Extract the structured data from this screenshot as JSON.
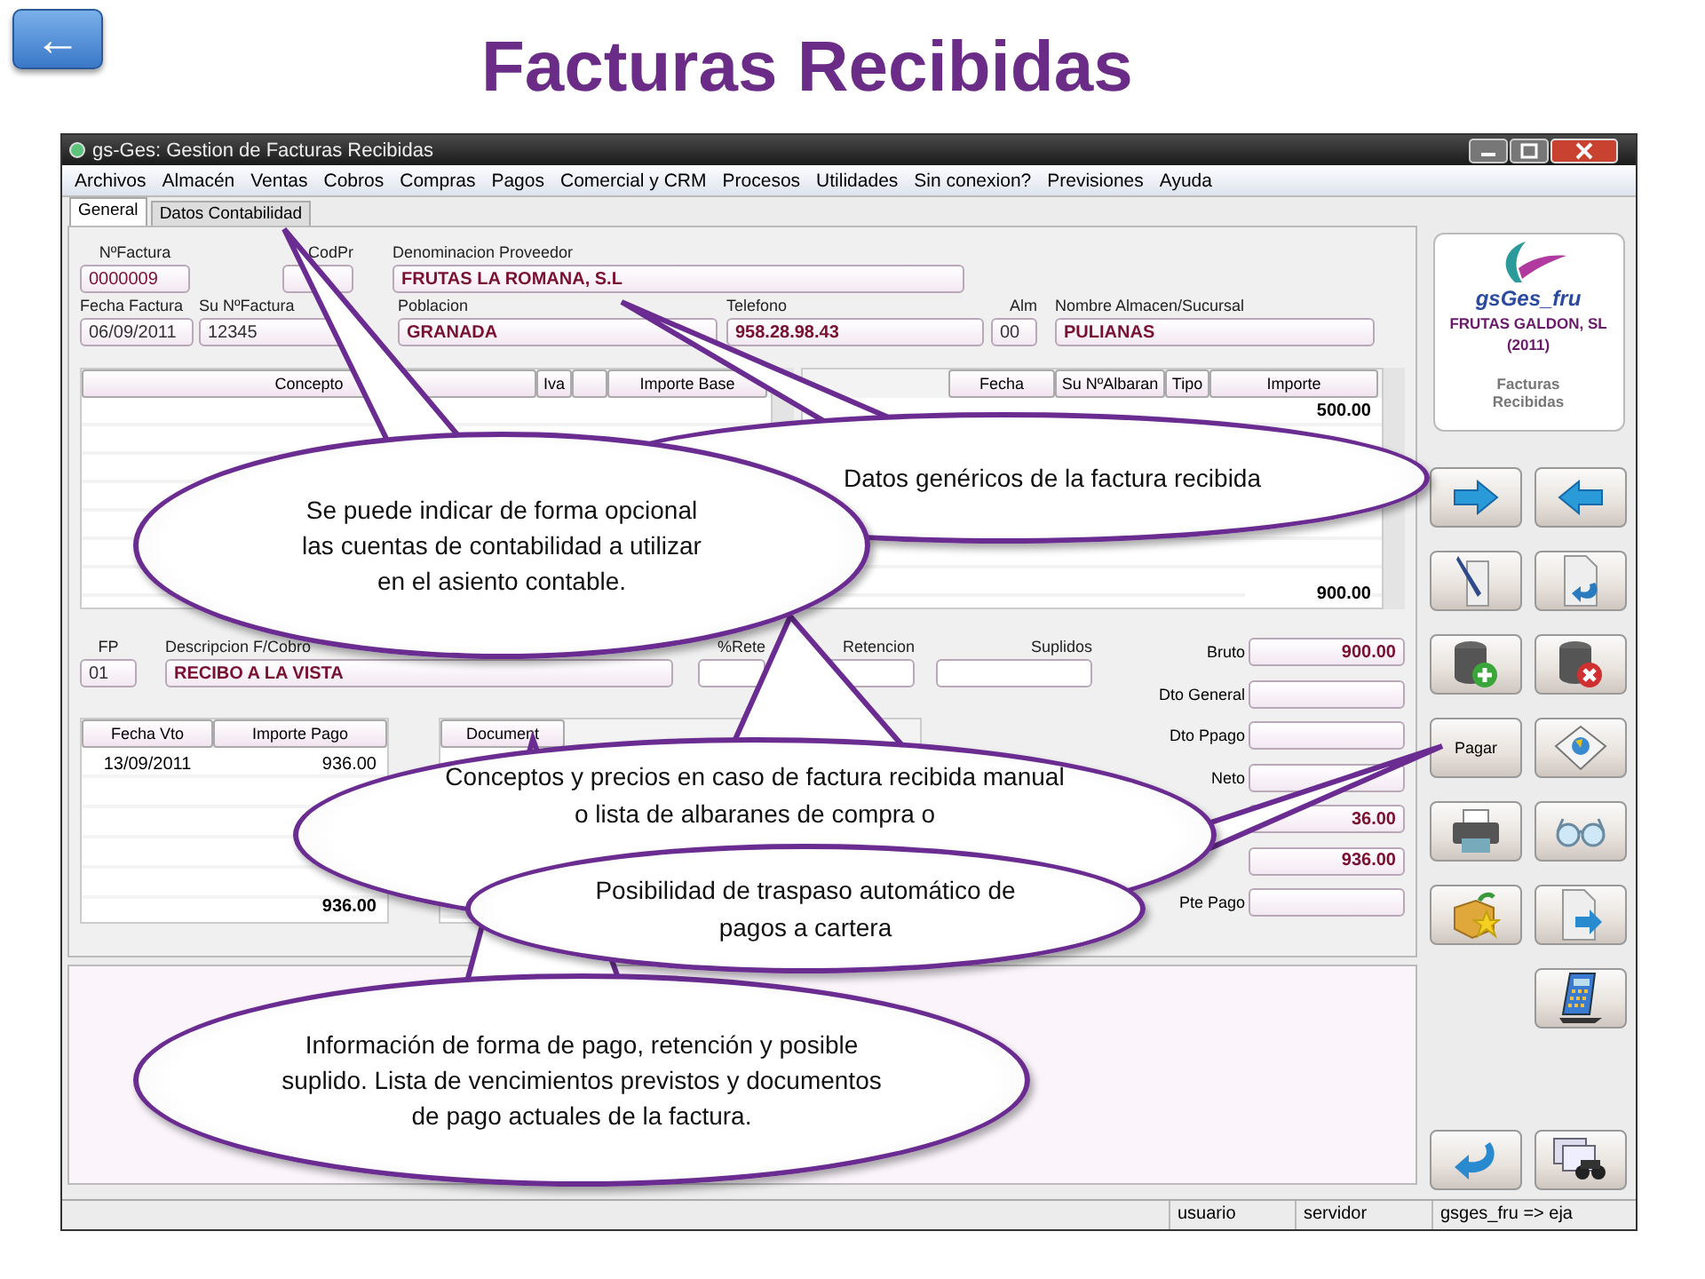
{
  "slide": {
    "back": "←",
    "title": "Facturas Recibidas"
  },
  "window": {
    "title": "gs-Ges: Gestion de Facturas Recibidas"
  },
  "menu": [
    "Archivos",
    "Almacén",
    "Ventas",
    "Cobros",
    "Compras",
    "Pagos",
    "Comercial y CRM",
    "Procesos",
    "Utilidades",
    "Sin conexion?",
    "Previsiones",
    "Ayuda"
  ],
  "tabs": [
    {
      "label": "General",
      "selected": true
    },
    {
      "label": "Datos Contabilidad",
      "selected": false
    }
  ],
  "header_rows": [
    [
      {
        "label": "NºFactura",
        "value": "0000009"
      },
      {
        "label": "CodPr"
      },
      {
        "label": "Denominacion Proveedor",
        "value": "FRUTAS LA ROMANA, S.L"
      }
    ],
    [
      {
        "label": "Fecha Factura",
        "value": "06/09/2011"
      },
      {
        "label": "Su NºFactura",
        "value": "12345"
      },
      {
        "label": "Poblacion",
        "value": "GRANADA"
      },
      {
        "label": "Telefono",
        "value": "958.28.98.43"
      },
      {
        "label": "Alm",
        "value": "00"
      },
      {
        "label": "Nombre Almacen/Sucursal",
        "value": "PULIANAS"
      }
    ]
  ],
  "concept_table": {
    "columns": [
      "Concepto",
      "Iva",
      "Importe Base"
    ]
  },
  "albaran_table": {
    "columns": [
      "Fecha",
      "Su NºAlbaran",
      "Tipo",
      "Importe"
    ],
    "first_amount": "500.00",
    "total": "900.00"
  },
  "payment": [
    {
      "label": "FP",
      "value": "01"
    },
    {
      "label": "Descripcion F/Cobro",
      "value": "RECIBO A LA VISTA"
    },
    {
      "label": "%Rete"
    },
    {
      "label": "Retencion"
    },
    {
      "label": "Suplidos"
    }
  ],
  "totals": [
    {
      "label": "Bruto",
      "value": "900.00"
    },
    {
      "label": "Dto General"
    },
    {
      "label": "Dto Ppago"
    },
    {
      "label": "Neto"
    },
    {
      "value": "36.00"
    },
    {
      "value": "936.00"
    },
    {
      "label": "Pte Pago"
    }
  ],
  "due_table": {
    "columns": [
      "Fecha Vto",
      "Importe Pago"
    ],
    "rows": [
      {
        "date": "13/09/2011",
        "amount": "936.00"
      }
    ],
    "total": "936.00"
  },
  "documents_table": {
    "columns": [
      "Document"
    ]
  },
  "company_card": {
    "logo": "gsGes_fru",
    "company": "FRUTAS GALDON, SL",
    "year": "(2011)",
    "module": "Facturas Recibidas"
  },
  "pay_button": "Pagar",
  "status_bar": [
    "usuario",
    "servidor",
    "gsges_fru => eja"
  ],
  "callouts": [
    "Se puede indicar de forma opcional las cuentas de contabilidad a utilizar en el asiento contable.",
    "Datos genéricos de la factura recibida",
    "Conceptos y precios en caso de factura recibida manual o lista de albaranes de compra o",
    "Información de forma de pago, retención y posible suplido. Lista de vencimientos previstos y documentos de pago actuales de la factura.",
    "Posibilidad de traspaso automático de pagos a cartera"
  ]
}
